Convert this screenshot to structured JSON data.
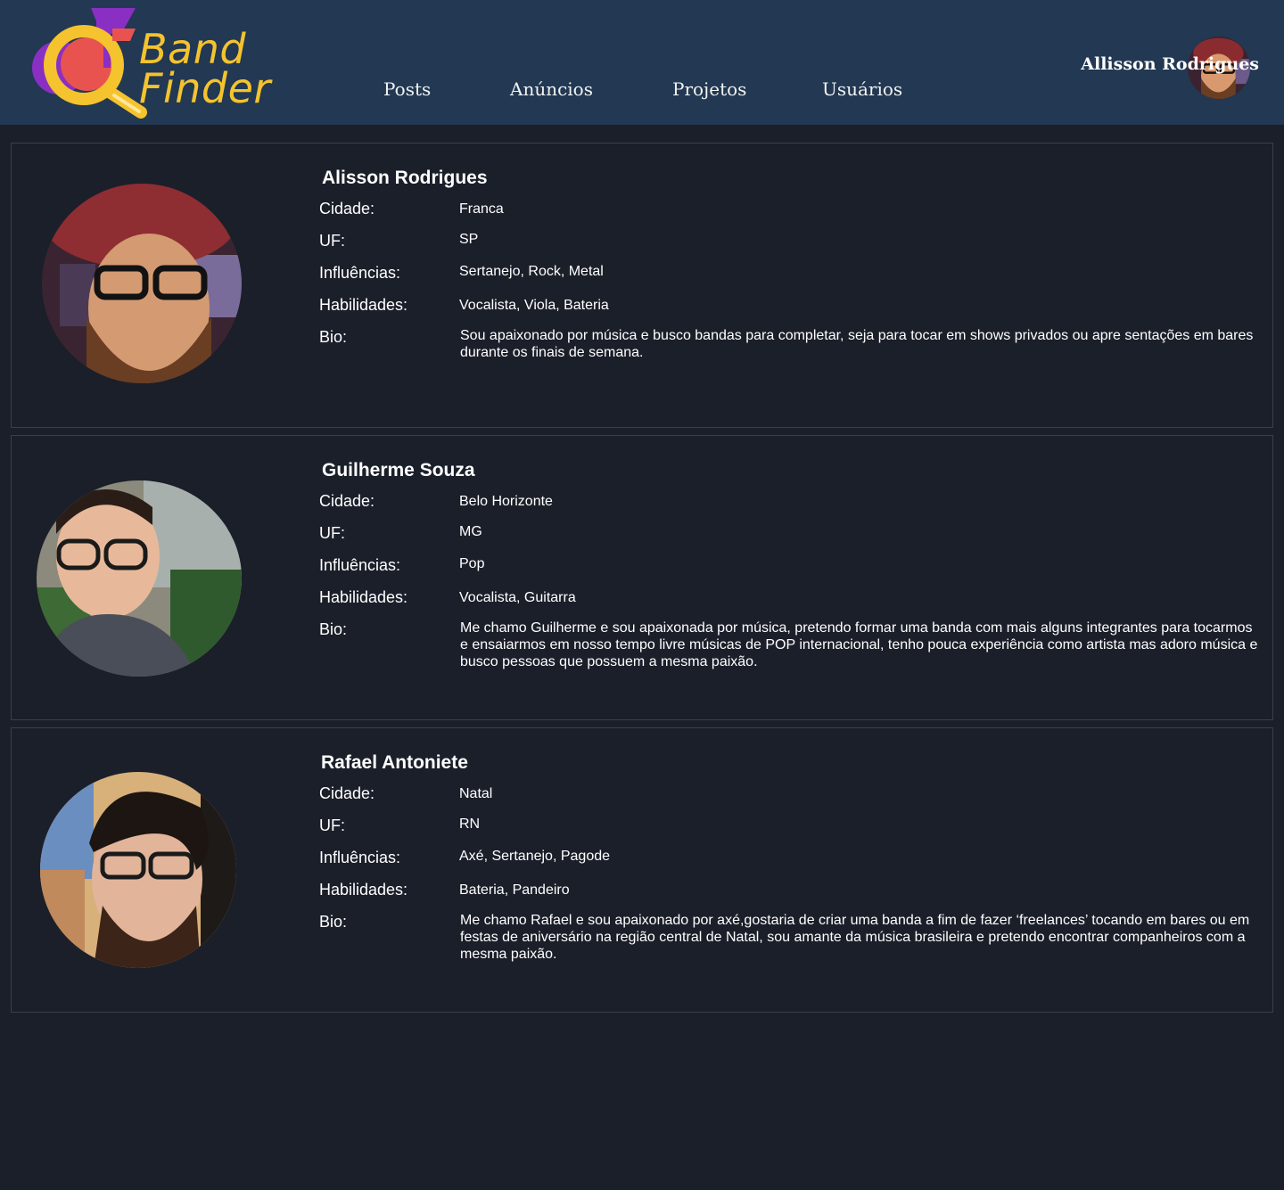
{
  "app": {
    "logo_line1": "Band",
    "logo_line2": "Finder"
  },
  "nav": [
    {
      "label": "Posts"
    },
    {
      "label": "Anúncios"
    },
    {
      "label": "Projetos"
    },
    {
      "label": "Usuários"
    }
  ],
  "current_user": {
    "name": "Allisson Rodrigues"
  },
  "field_labels": {
    "city": "Cidade:",
    "state": "UF:",
    "influences": "Influências:",
    "skills": "Habilidades:",
    "bio": "Bio:"
  },
  "users": [
    {
      "name": "Alisson Rodrigues",
      "city": "Franca",
      "state": "SP",
      "influences": "Sertanejo, Rock, Metal",
      "skills": "Vocalista, Viola, Bateria",
      "bio": "Sou apaixonado por música e busco bandas para completar, seja para tocar em shows privados ou apre sentações em bares durante os finais de semana."
    },
    {
      "name": "Guilherme Souza",
      "city": "Belo Horizonte",
      "state": "MG",
      "influences": "Pop",
      "skills": "Vocalista, Guitarra",
      "bio": "Me chamo Guilherme e sou apaixonada por música, pretendo formar uma banda com mais alguns integrantes para tocarmos e ensaiarmos em nosso tempo livre músicas de POP internacional, tenho pouca experiência como artista mas adoro música e busco pessoas que possuem a mesma  paixão."
    },
    {
      "name": "Rafael Antoniete",
      "city": "Natal",
      "state": "RN",
      "influences": "Axé, Sertanejo, Pagode",
      "skills": "Bateria, Pandeiro",
      "bio": "Me chamo Rafael e sou apaixonado por axé,gostaria de criar uma banda a fim de fazer ‘freelances’ tocando em bares ou em festas de aniversário na região central de Natal, sou amante da música brasileira e pretendo encontrar companheiros com a mesma paixão."
    }
  ],
  "colors": {
    "header_bg": "#223853",
    "page_bg": "#1b1f2a",
    "logo_yellow": "#f4c32d",
    "logo_purple": "#8a2fc4",
    "logo_red": "#e8534f",
    "card_border": "#3a3f4b"
  }
}
